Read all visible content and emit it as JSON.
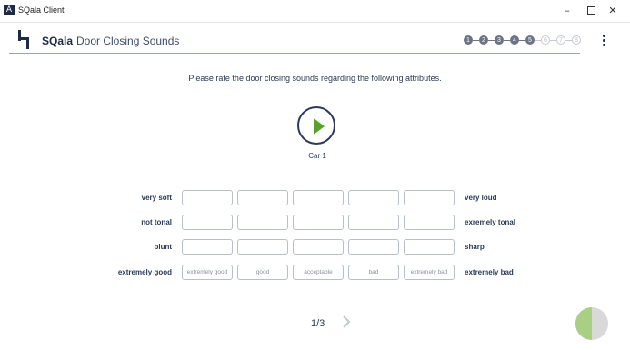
{
  "window": {
    "app_icon_glyph": "A",
    "title": "SQala Client",
    "minimize_glyph": "–",
    "close_glyph": "✕"
  },
  "header": {
    "brand": "SQala",
    "survey_title": "Door Closing Sounds",
    "steps": [
      {
        "label": "1",
        "state": "done"
      },
      {
        "label": "2",
        "state": "done"
      },
      {
        "label": "3",
        "state": "done"
      },
      {
        "label": "4",
        "state": "done"
      },
      {
        "label": "5",
        "state": "done"
      },
      {
        "label": "6",
        "state": "todo"
      },
      {
        "label": "7",
        "state": "todo"
      },
      {
        "label": "8",
        "state": "todo"
      }
    ]
  },
  "main": {
    "prompt": "Please rate the door closing sounds regarding the following attributes.",
    "player_label": "Car 1",
    "scales": [
      {
        "left": "very soft",
        "right": "very loud",
        "cells": [
          "",
          "",
          "",
          "",
          ""
        ]
      },
      {
        "left": "not tonal",
        "right": "exremely tonal",
        "cells": [
          "",
          "",
          "",
          "",
          ""
        ]
      },
      {
        "left": "blunt",
        "right": "sharp",
        "cells": [
          "",
          "",
          "",
          "",
          ""
        ]
      },
      {
        "left": "extremely good",
        "right": "extremely bad",
        "cells": [
          "extremely good",
          "good",
          "acceptable",
          "bad",
          "extremely bad"
        ]
      }
    ]
  },
  "footer": {
    "page_indicator": "1/3",
    "progress_fraction": 0.5
  },
  "colors": {
    "accent_green": "#5aa02c",
    "pie_green": "#a9cf84",
    "pie_gray": "#d9d9d9",
    "navy": "#1f2a44"
  },
  "icons": {
    "play": "play-icon",
    "next": "chevron-right-icon",
    "menu": "more-vertical-icon"
  }
}
